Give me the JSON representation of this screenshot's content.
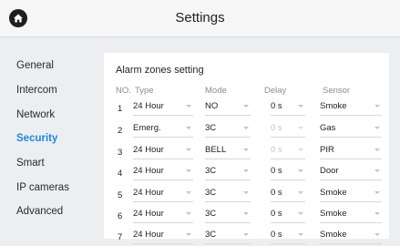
{
  "header": {
    "title": "Settings",
    "home_icon": "home-icon"
  },
  "sidebar": {
    "active_color": "#1e88e5",
    "items": [
      {
        "label": "General"
      },
      {
        "label": "Intercom"
      },
      {
        "label": "Network"
      },
      {
        "label": "Security",
        "active": true
      },
      {
        "label": "Smart"
      },
      {
        "label": "IP cameras"
      },
      {
        "label": "Advanced"
      }
    ]
  },
  "panel": {
    "title": "Alarm zones setting",
    "columns": {
      "no": "NO.",
      "type": "Type",
      "mode": "Mode",
      "delay": "Delay",
      "sensor": "Sensor"
    },
    "rows": [
      {
        "no": "1",
        "type": "24 Hour",
        "mode": "NO",
        "delay": "0 s",
        "delay_disabled": false,
        "sensor": "Smoke"
      },
      {
        "no": "2",
        "type": "Emerg.",
        "mode": "3C",
        "delay": "0 s",
        "delay_disabled": true,
        "sensor": "Gas"
      },
      {
        "no": "3",
        "type": "24 Hour",
        "mode": "BELL",
        "delay": "0 s",
        "delay_disabled": true,
        "sensor": "PIR"
      },
      {
        "no": "4",
        "type": "24 Hour",
        "mode": "3C",
        "delay": "0 s",
        "delay_disabled": false,
        "sensor": "Door"
      },
      {
        "no": "5",
        "type": "24 Hour",
        "mode": "3C",
        "delay": "0 s",
        "delay_disabled": false,
        "sensor": "Smoke"
      },
      {
        "no": "6",
        "type": "24 Hour",
        "mode": "3C",
        "delay": "0 s",
        "delay_disabled": false,
        "sensor": "Smoke"
      },
      {
        "no": "7",
        "type": "24 Hour",
        "mode": "3C",
        "delay": "0 s",
        "delay_disabled": false,
        "sensor": "Smoke"
      }
    ]
  }
}
